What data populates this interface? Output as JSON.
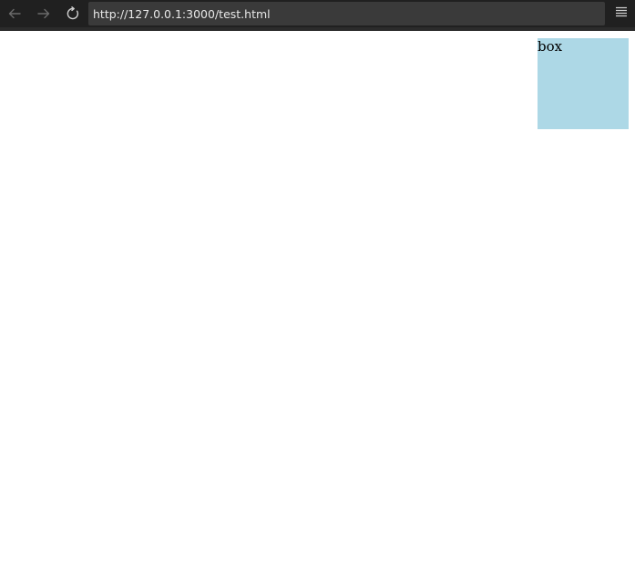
{
  "browser": {
    "url": "http://127.0.0.1:3000/test.html",
    "icons": {
      "back": "arrow-left-icon",
      "forward": "arrow-right-icon",
      "reload": "reload-icon",
      "menu": "hamburger-menu-icon"
    },
    "colors": {
      "toolbar": "#202020",
      "url_bar": "#3a3a3a",
      "icon_disabled": "#6b6b6b",
      "icon_enabled": "#d0d0d0"
    }
  },
  "page": {
    "box": {
      "label": "box",
      "color": "#add8e6"
    }
  }
}
